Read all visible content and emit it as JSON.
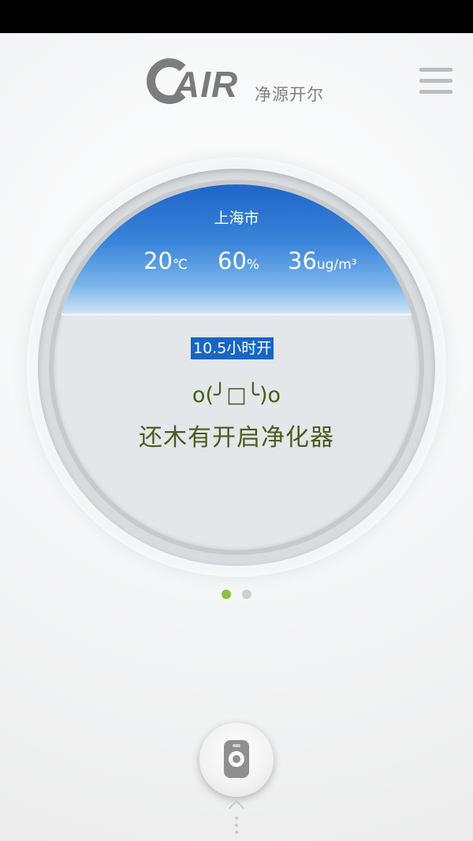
{
  "app": {
    "logo_text": "AIR",
    "logo_subtitle": "净源开尔"
  },
  "weather": {
    "city": "上海市",
    "temperature": {
      "value": "20",
      "unit": "℃"
    },
    "humidity": {
      "value": "60",
      "unit": "%"
    },
    "pm25": {
      "value": "36",
      "unit": "ug/m³"
    }
  },
  "purifier": {
    "timer_label": "10.5小时开",
    "emoticon": "o(╯□╰)o",
    "status_message": "还木有开启净化器"
  },
  "pager": {
    "current_page": 1,
    "total_pages": 2
  },
  "icons": {
    "menu": "menu-icon",
    "remote": "remote-control-icon",
    "expand": "chevron-up-icon"
  },
  "colors": {
    "sky_top": "#1d66c9",
    "timer_highlight": "#1766c4",
    "status_text": "#4d5a1e",
    "active_dot": "#8ac23a"
  }
}
